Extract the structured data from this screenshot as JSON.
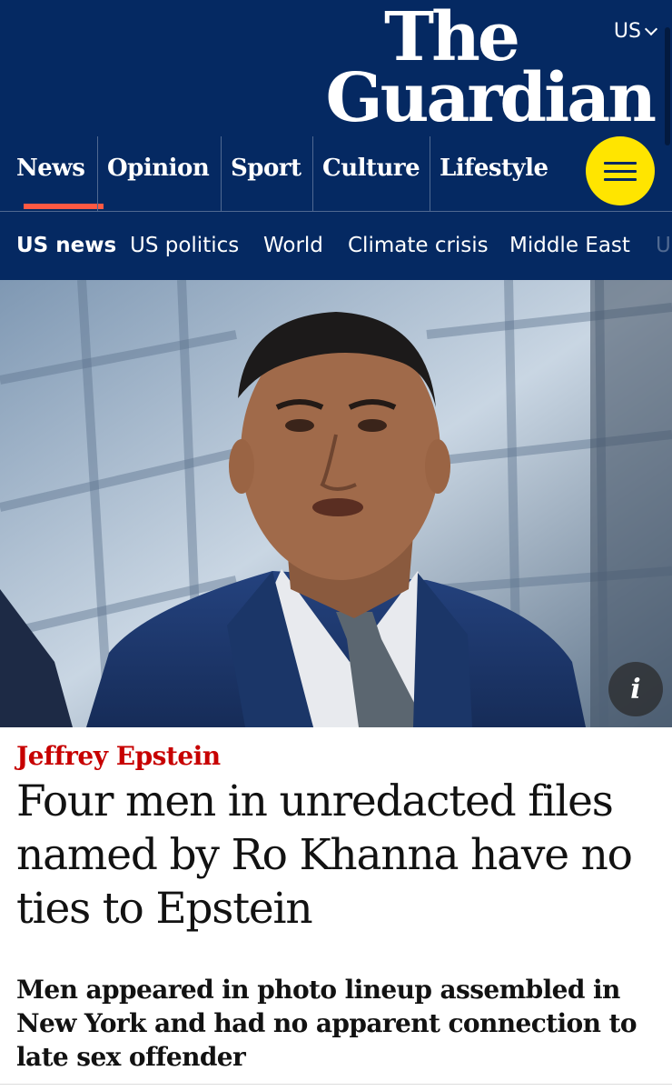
{
  "header": {
    "edition_label": "US",
    "logo_line1": "The",
    "logo_line2": "Guardian",
    "background": "#052962"
  },
  "pillars": [
    {
      "label": "News",
      "active": true
    },
    {
      "label": "Opinion"
    },
    {
      "label": "Sport"
    },
    {
      "label": "Culture"
    },
    {
      "label": "Lifestyle"
    }
  ],
  "menu_icon": "hamburger-menu-icon",
  "subnav": [
    {
      "label": "US news",
      "active": true
    },
    {
      "label": "US politics"
    },
    {
      "label": "World"
    },
    {
      "label": "Climate crisis"
    },
    {
      "label": "Middle East"
    },
    {
      "label": "U"
    }
  ],
  "hero": {
    "info_label": "i"
  },
  "article": {
    "kicker": "Jeffrey Epstein",
    "headline": "Four men in unredacted files named by Ro Khanna have no ties to Epstein",
    "standfirst": "Men appeared in photo lineup assembled in New York and had no apparent connection to late sex offender"
  },
  "colors": {
    "brand_blue": "#052962",
    "accent_red": "#c70000",
    "menu_yellow": "#ffe500",
    "active_underline": "#ff5943"
  }
}
